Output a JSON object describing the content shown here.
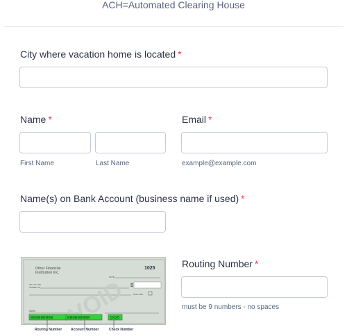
{
  "header": {
    "text": "ACH=Automated Clearing House"
  },
  "fields": {
    "city": {
      "label": "City where vacation home is located",
      "required": "*"
    },
    "name": {
      "label": "Name",
      "required": "*",
      "first_sublabel": "First Name",
      "last_sublabel": "Last Name"
    },
    "email": {
      "label": "Email",
      "required": "*",
      "sublabel": "example@example.com"
    },
    "bank_account_name": {
      "label": "Name(s) on Bank Account (business name if used)",
      "required": "*"
    },
    "routing": {
      "label": "Routing Number",
      "required": "*",
      "sublabel": "must be 9 numbers - no spaces"
    }
  },
  "check_image": {
    "bank_name_line1": "Other Financial",
    "bank_name_line2": "Institution Inc.",
    "check_number": "1025",
    "date_label": "DATE",
    "pay_to_label_line1": "PAY TO THE",
    "pay_to_label_line2": "ORDER OF",
    "dollar_sign": "$",
    "dollars_label": "DOLLARS",
    "memo_label": "MEMO",
    "watermark": "VOID",
    "routing_digits": "000000000",
    "account_digits": "000000000",
    "check_digits": "1025",
    "caption_routing": "Routing Number",
    "caption_account": "Account Number",
    "caption_check": "Check Number"
  },
  "colors": {
    "required": "#f23a3c",
    "highlight": "#35d03d",
    "border": "#c3cad8"
  }
}
